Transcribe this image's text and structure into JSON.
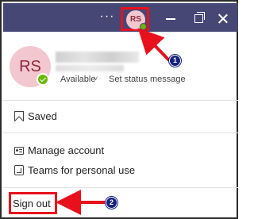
{
  "titlebar": {
    "more_label": "···",
    "avatar_initials": "RS"
  },
  "profile": {
    "initials": "RS",
    "availability": "Available",
    "availability_chevron": "˅",
    "status_message": "Set status message"
  },
  "menu": {
    "saved": "Saved",
    "manage_account": "Manage account",
    "teams_personal": "Teams for personal use",
    "sign_out": "Sign out"
  },
  "annotations": {
    "step1": "1",
    "step2": "2",
    "arrow_color": "#e8101c",
    "badge_color": "#15217e"
  },
  "colors": {
    "titlebar": "#464775",
    "avatar_bg": "#f3c7cf",
    "status_available": "#6bb700"
  }
}
